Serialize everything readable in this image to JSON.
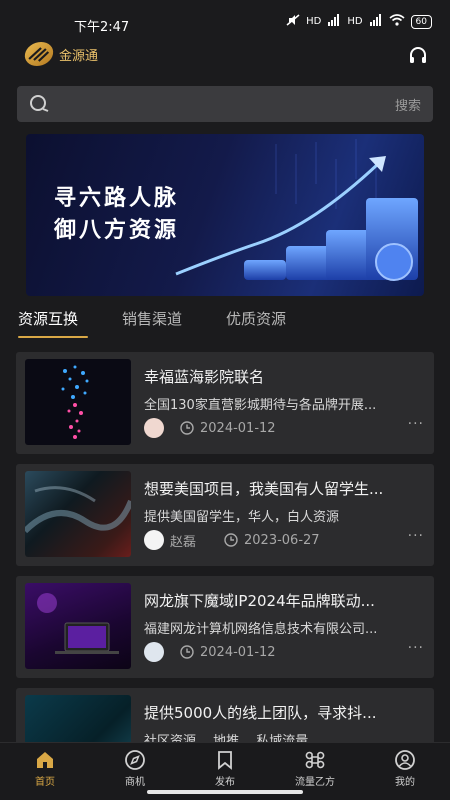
{
  "status_bar": {
    "time": "下午2:47",
    "net1": "HD",
    "net2": "HD",
    "battery": "60"
  },
  "header": {
    "app_name": "金源通",
    "logo_icon": "gold-logo-icon",
    "right_icon": "headset-icon"
  },
  "search": {
    "icon": "search-icon",
    "button_label": "搜索"
  },
  "banner": {
    "line1": "寻六路人脉",
    "line2": "御八方资源"
  },
  "tabs": [
    {
      "label": "资源互换",
      "active": true
    },
    {
      "label": "销售渠道",
      "active": false
    },
    {
      "label": "优质资源",
      "active": false
    }
  ],
  "cards": [
    {
      "title": " 幸福蓝海影院联名",
      "subtitle": "全国130家直营影城期待与各品牌开展...",
      "author": "",
      "date": "2024-01-12"
    },
    {
      "title": "想要美国项目，我美国有人留学生...",
      "subtitle": "提供美国留学生，华人，白人资源",
      "author": "赵磊",
      "date": "2023-06-27"
    },
    {
      "title": "网龙旗下魔域IP2024年品牌联动...",
      "subtitle": "福建网龙计算机网络信息技术有限公司...",
      "author": "",
      "date": "2024-01-12"
    },
    {
      "title": "提供5000人的线上团队，寻求抖...",
      "subtitle": "社区资源， 地推， 私域流量",
      "author": "",
      "date": ""
    }
  ],
  "more_glyph": "···",
  "bottom_nav": [
    {
      "label": "首页",
      "icon": "home-icon",
      "active": true
    },
    {
      "label": "商机",
      "icon": "compass-icon",
      "active": false
    },
    {
      "label": "发布",
      "icon": "bookmark-icon",
      "active": false
    },
    {
      "label": "流量乙方",
      "icon": "command-icon",
      "active": false
    },
    {
      "label": "我的",
      "icon": "user-icon",
      "active": false
    }
  ],
  "colors": {
    "accent": "#d9a846",
    "background": "#1b1b1d",
    "card": "#2c2c2e"
  }
}
